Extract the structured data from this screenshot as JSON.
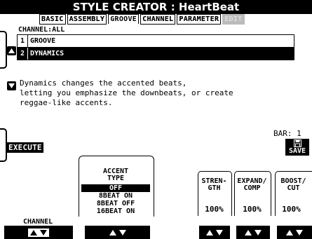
{
  "header": {
    "title": "STYLE CREATOR : HeartBeat"
  },
  "tabs": [
    {
      "label": "BASIC",
      "state": "outlined"
    },
    {
      "label": "ASSEMBLY",
      "state": "outlined"
    },
    {
      "label": "GROOVE",
      "state": "active"
    },
    {
      "label": "CHANNEL",
      "state": "outlined"
    },
    {
      "label": "PARAMETER",
      "state": "outlined"
    },
    {
      "label": "EDIT",
      "state": "disabled"
    }
  ],
  "channel_label": "CHANNEL:ALL",
  "list": {
    "items": [
      {
        "num": "1",
        "name": "GROOVE",
        "selected": false
      },
      {
        "num": "2",
        "name": "DYNAMICS",
        "selected": true
      }
    ]
  },
  "description": {
    "lines": [
      "Dynamics changes the accented beats,",
      "letting you emphasize the downbeats, or create",
      "reggae-like accents."
    ]
  },
  "execute_label": "EXECUTE",
  "bar": {
    "label": "BAR:",
    "value": "1"
  },
  "save_label": "SAVE",
  "accent": {
    "heading_line1": "ACCENT",
    "heading_line2": "TYPE",
    "options": [
      "OFF",
      "8BEAT ON",
      "8BEAT OFF",
      "16BEAT ON"
    ],
    "selected_index": 0
  },
  "channel_bottom_label": "CHANNEL",
  "params": [
    {
      "head1": "STREN-",
      "head2": "GTH",
      "value": "100%"
    },
    {
      "head1": "EXPAND/",
      "head2": "COMP",
      "value": "100%"
    },
    {
      "head1": "BOOST/",
      "head2": "CUT",
      "value": "100%"
    }
  ]
}
